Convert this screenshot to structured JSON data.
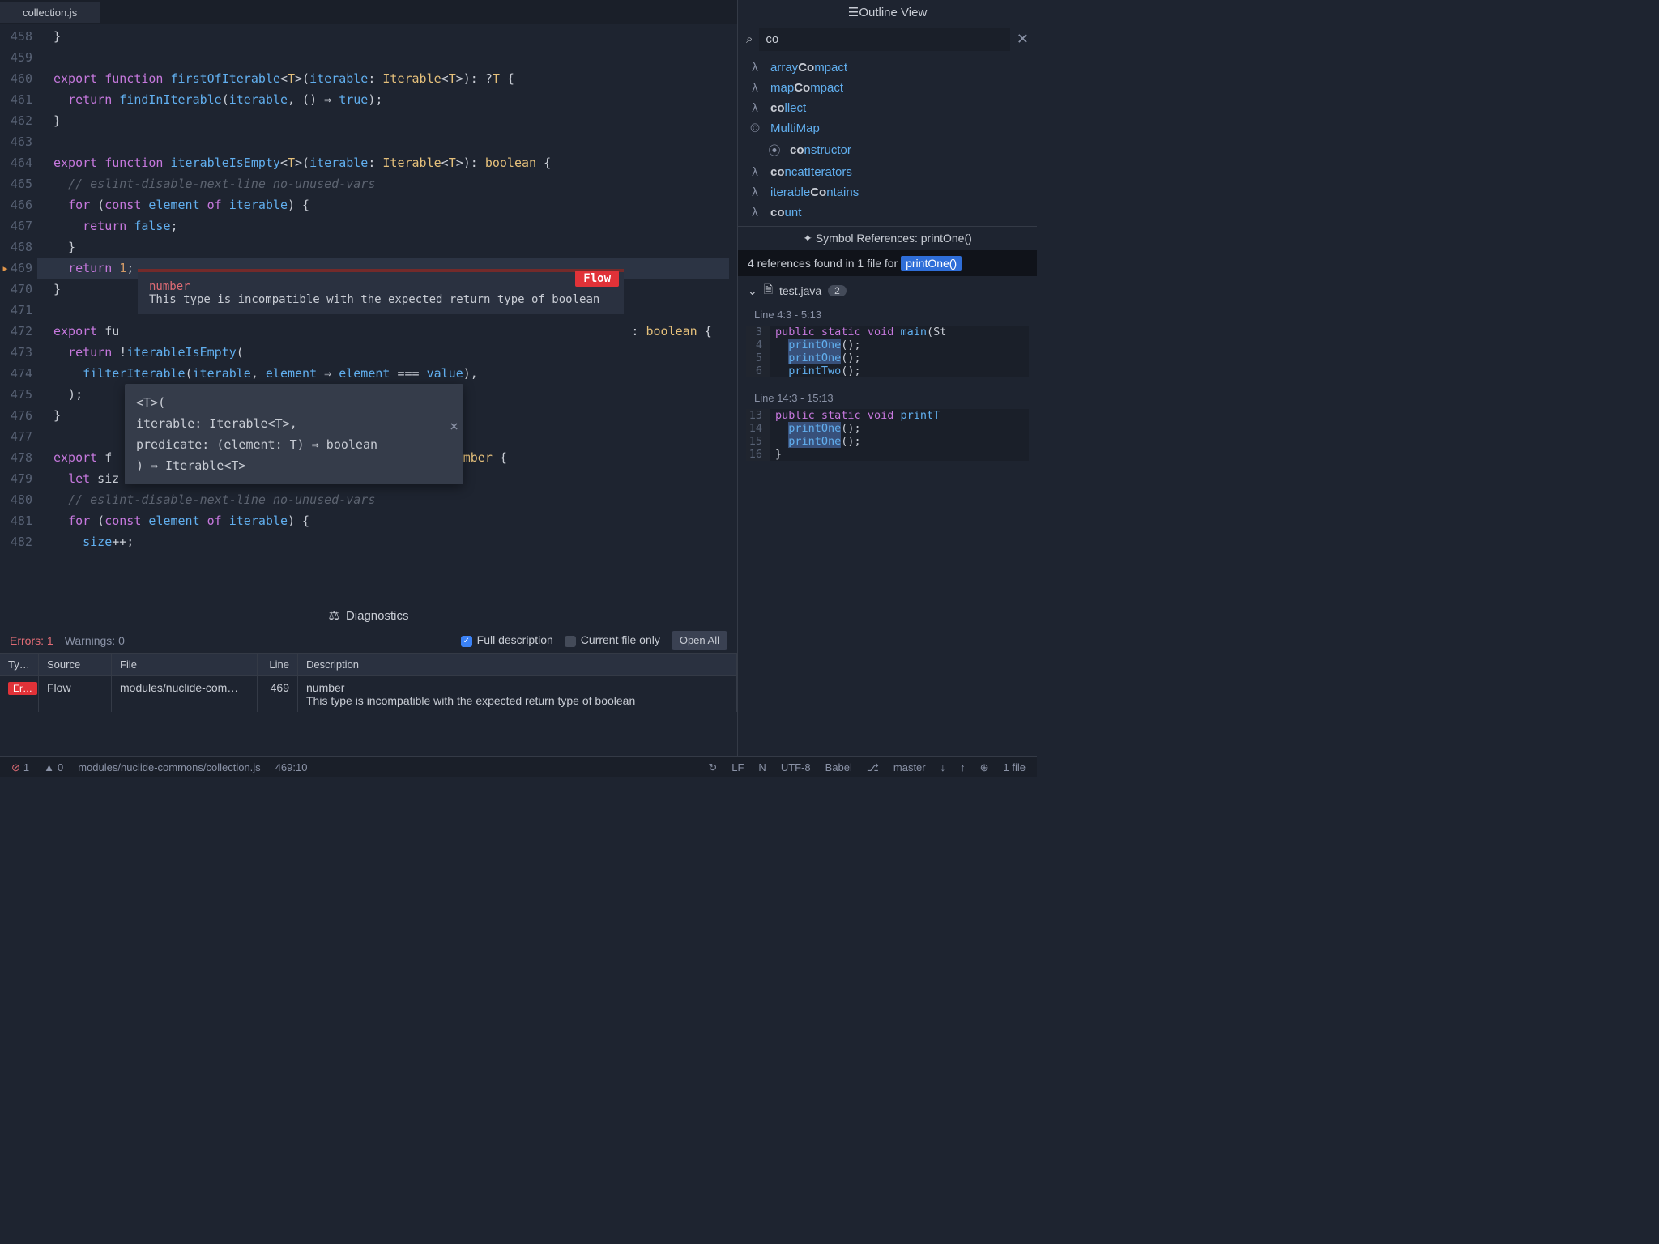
{
  "tab": {
    "title": "collection.js"
  },
  "editor": {
    "lines": [
      {
        "n": 458,
        "t": "}"
      },
      {
        "n": 459,
        "t": ""
      },
      {
        "n": 460,
        "t": "export function firstOfIterable<T>(iterable: Iterable<T>): ?T {"
      },
      {
        "n": 461,
        "t": "  return findInIterable(iterable, () ⇒ true);"
      },
      {
        "n": 462,
        "t": "}"
      },
      {
        "n": 463,
        "t": ""
      },
      {
        "n": 464,
        "t": "export function iterableIsEmpty<T>(iterable: Iterable<T>): boolean {"
      },
      {
        "n": 465,
        "t": "  // eslint-disable-next-line no-unused-vars"
      },
      {
        "n": 466,
        "t": "  for (const element of iterable) {"
      },
      {
        "n": 467,
        "t": "    return false;"
      },
      {
        "n": 468,
        "t": "  }"
      },
      {
        "n": 469,
        "t": "  return 1;",
        "arrow": true,
        "hl": true
      },
      {
        "n": 470,
        "t": "}"
      },
      {
        "n": 471,
        "t": ""
      },
      {
        "n": 472,
        "t": "export fu                                                                      : boolean {"
      },
      {
        "n": 473,
        "t": "  return !iterableIsEmpty("
      },
      {
        "n": 474,
        "t": "    filterIterable(iterable, element ⇒ element === value),"
      },
      {
        "n": 475,
        "t": "  );"
      },
      {
        "n": 476,
        "t": "}"
      },
      {
        "n": 477,
        "t": ""
      },
      {
        "n": 478,
        "t": "export f                                              number {"
      },
      {
        "n": 479,
        "t": "  let siz"
      },
      {
        "n": 480,
        "t": "  // eslint-disable-next-line no-unused-vars"
      },
      {
        "n": 481,
        "t": "  for (const element of iterable) {"
      },
      {
        "n": 482,
        "t": "    size++;"
      }
    ]
  },
  "err_popup": {
    "flow_label": "Flow",
    "title": "number",
    "msg": "This type is incompatible with the expected return type of boolean"
  },
  "sig_popup": {
    "l1": "<T>(",
    "l2": "  iterable: Iterable<T>,",
    "l3": "  predicate: (element: T) ⇒ boolean",
    "l4": ") ⇒ Iterable<T>"
  },
  "diagnostics": {
    "title": "Diagnostics",
    "errors_label": "Errors: 1",
    "warnings_label": "Warnings: 0",
    "full_desc": "Full description",
    "current_file": "Current file only",
    "open_all": "Open All",
    "headers": {
      "type": "Ty…",
      "source": "Source",
      "file": "File",
      "line": "Line",
      "desc": "Description"
    },
    "row": {
      "type": "Er…",
      "source": "Flow",
      "file": "modules/nuclide-com…",
      "line": "469",
      "desc1": "number",
      "desc2": "This type is incompatible with the expected return type of boolean"
    }
  },
  "outline": {
    "title": "Outline View",
    "search_value": "co",
    "items": [
      {
        "icon": "λ",
        "parts": [
          "array",
          "Co",
          "mpact"
        ]
      },
      {
        "icon": "λ",
        "parts": [
          "map",
          "Co",
          "mpact"
        ]
      },
      {
        "icon": "λ",
        "parts": [
          "co",
          "llect"
        ]
      },
      {
        "icon": "©",
        "parts": [
          "MultiMap"
        ],
        "muted": true
      },
      {
        "icon": "⦿",
        "parts": [
          "co",
          "nstructor"
        ],
        "child": true
      },
      {
        "icon": "λ",
        "parts": [
          "co",
          "ncatIterators"
        ]
      },
      {
        "icon": "λ",
        "parts": [
          "iterable",
          "Co",
          "ntains"
        ]
      },
      {
        "icon": "λ",
        "parts": [
          "co",
          "unt"
        ]
      }
    ]
  },
  "refs": {
    "title": "Symbol References: printOne()",
    "summary_a": "4 references found in 1 file for ",
    "summary_b": "printOne()",
    "file": "test.java",
    "count": "2",
    "loc1": "Line 4:3 - 5:13",
    "loc2": "Line 14:3 - 15:13",
    "block1": [
      {
        "ln": "3",
        "txt": "public static void main(St"
      },
      {
        "ln": "4",
        "txt": "  printOne();",
        "hl": "printOne"
      },
      {
        "ln": "5",
        "txt": "  printOne();",
        "hl": "printOne"
      },
      {
        "ln": "6",
        "txt": "  printTwo();"
      }
    ],
    "block2": [
      {
        "ln": "13",
        "txt": "public static void printT"
      },
      {
        "ln": "14",
        "txt": "  printOne();",
        "hl": "printOne"
      },
      {
        "ln": "15",
        "txt": "  printOne();",
        "hl": "printOne"
      },
      {
        "ln": "16",
        "txt": "}"
      }
    ]
  },
  "status": {
    "err": "1",
    "warn": "0",
    "path": "modules/nuclide-commons/collection.js",
    "pos": "469:10",
    "lf": "LF",
    "n": "N",
    "enc": "UTF-8",
    "lang": "Babel",
    "branch": "master",
    "files": "1 file"
  }
}
